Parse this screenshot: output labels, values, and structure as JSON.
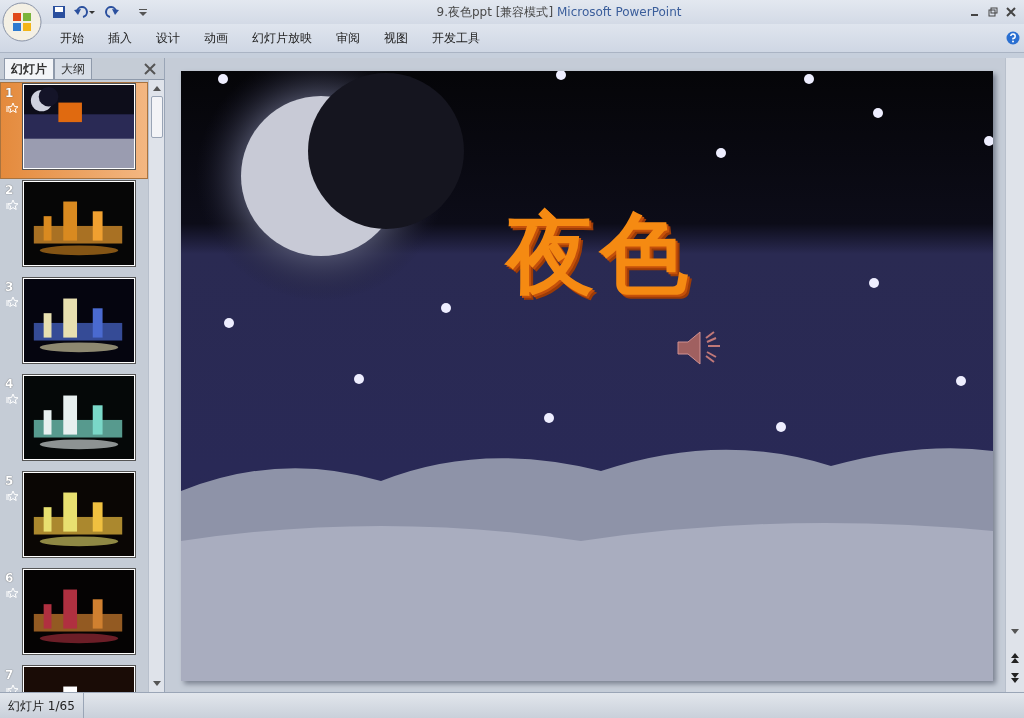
{
  "window": {
    "title": "9.夜色ppt [兼容模式]",
    "app": "Microsoft PowerPoint"
  },
  "ribbon_tabs": [
    "开始",
    "插入",
    "设计",
    "动画",
    "幻灯片放映",
    "审阅",
    "视图",
    "开发工具"
  ],
  "panel_tabs": [
    {
      "label": "幻灯片",
      "selected": true
    },
    {
      "label": "大纲",
      "selected": false
    }
  ],
  "slides": [
    {
      "number": "1",
      "selected": true
    },
    {
      "number": "2",
      "selected": false
    },
    {
      "number": "3",
      "selected": false
    },
    {
      "number": "4",
      "selected": false
    },
    {
      "number": "5",
      "selected": false
    },
    {
      "number": "6",
      "selected": false
    },
    {
      "number": "7",
      "selected": false
    }
  ],
  "slide": {
    "title": "夜色"
  },
  "status_bar": "幻灯片 1/65"
}
